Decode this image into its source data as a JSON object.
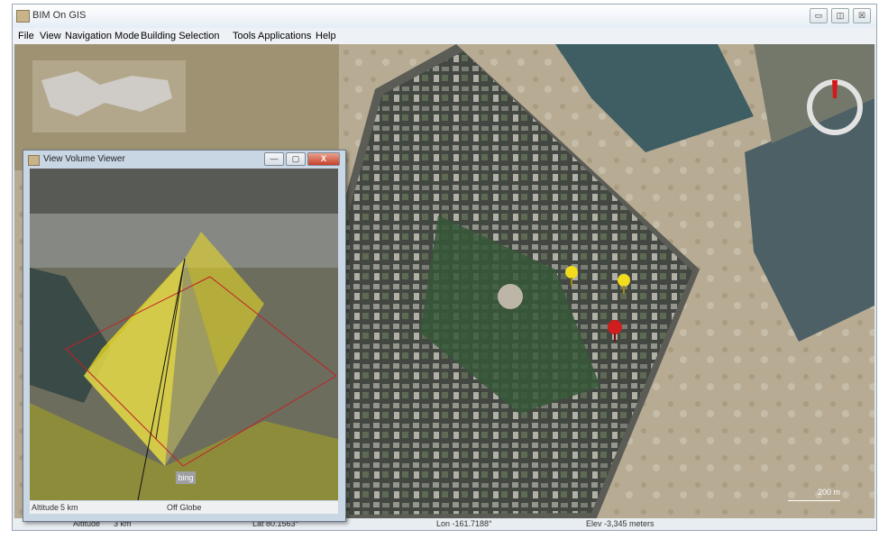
{
  "window": {
    "title": "BIM On GIS",
    "buttons": [
      "▭",
      "◫",
      "☒"
    ]
  },
  "menu": [
    "File",
    "View",
    "Navigation Mode",
    "Building Selection",
    "Tools",
    "Applications",
    "Help"
  ],
  "status": {
    "altitude_label": "Altitude",
    "altitude_value": "3 km",
    "lat": "Lat 80.1563°",
    "lon": "Lon -161.7188°",
    "elev": "Elev -3,345 meters"
  },
  "map": {
    "scale": "200 m"
  },
  "subwindow": {
    "title": "View Volume Viewer",
    "buttons": [
      "—",
      "▢",
      "X"
    ],
    "altitude_label": "Altitude",
    "altitude_value": "5 km",
    "globe_status": "Off Globe",
    "logo": "bing"
  },
  "colors": {
    "pin_yellow": "#f2dc1e",
    "pin_red": "#d01e1e",
    "frustum_yellow": "#f0e020",
    "compass_red": "#d41818"
  }
}
